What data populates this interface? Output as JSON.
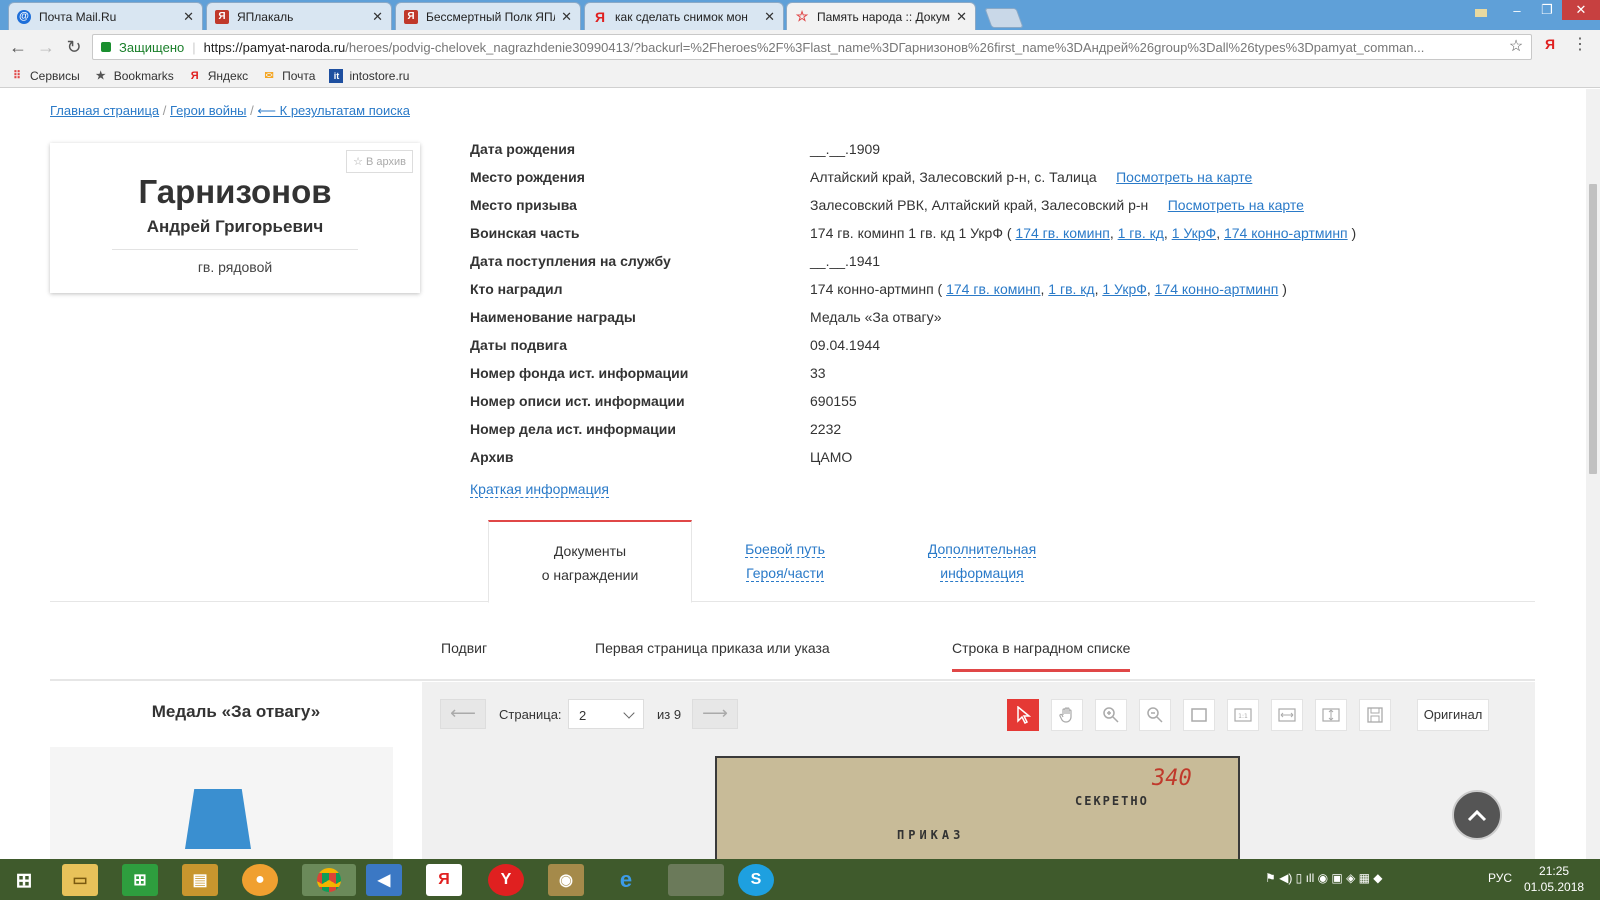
{
  "browser": {
    "tabs": [
      {
        "title": "Почта Mail.Ru",
        "icon": "mail-icon"
      },
      {
        "title": "ЯПлакаль",
        "icon": "yaplakal-icon"
      },
      {
        "title": "Бессмертный Полк ЯПл",
        "icon": "yaplakal-icon"
      },
      {
        "title": "как сделать снимок мон",
        "icon": "yandex-icon"
      },
      {
        "title": "Память народа :: Докум",
        "icon": "star-icon"
      }
    ],
    "secure_label": "Защищено",
    "url_host": "https://pamyat-naroda.ru",
    "url_rest": "/heroes/podvig-chelovek_nagrazhdenie30990413/?backurl=%2Fheroes%2F%3Flast_name%3DГарнизонов%26first_name%3DАндрей%26group%3Dall%26types%3Dpamyat_comman...",
    "bookmarks": [
      "Сервисы",
      "Bookmarks",
      "Яндекс",
      "Почта",
      "intostore.ru"
    ]
  },
  "breadcrumbs": {
    "home": "Главная страница",
    "sep1": "/",
    "heroes": "Герои войны",
    "sep2": "/",
    "back": "⟵ К результатам поиска"
  },
  "person": {
    "archive_button": "☆ В архив",
    "surname": "Гарнизонов",
    "name": "Андрей Григорьевич",
    "rank": "гв. рядовой"
  },
  "info": [
    {
      "label": "Дата рождения",
      "value": "__.__.1909"
    },
    {
      "label": "Место рождения",
      "value": "Алтайский край, Залесовский р-н, с. Талица",
      "link": "Посмотреть на карте"
    },
    {
      "label": "Место призыва",
      "value": "Залесовский РВК, Алтайский край, Залесовский р-н",
      "link": "Посмотреть на карте"
    },
    {
      "label": "Воинская часть",
      "value": "174 гв. коминп 1 гв. кд 1 УкрФ (",
      "links": [
        "174 гв. коминп",
        "1 гв. кд",
        "1 УкрФ",
        "174 конно-артминп"
      ],
      "tail": ")"
    },
    {
      "label": "Дата поступления на службу",
      "value": "__.__.1941"
    },
    {
      "label": "Кто наградил",
      "value": "174 конно-артминп (",
      "links": [
        "174 гв. коминп",
        "1 гв. кд",
        "1 УкрФ",
        "174 конно-артминп"
      ],
      "tail": ")"
    },
    {
      "label": "Наименование награды",
      "value": "Медаль «За отвагу»"
    },
    {
      "label": "Даты подвига",
      "value": "09.04.1944"
    },
    {
      "label": "Номер фонда ист. информации",
      "value": "33"
    },
    {
      "label": "Номер описи ист. информации",
      "value": "690155"
    },
    {
      "label": "Номер дела ист. информации",
      "value": "2232"
    },
    {
      "label": "Архив",
      "value": "ЦАМО"
    }
  ],
  "short_info_link": "Краткая информация",
  "tabs": [
    {
      "line1": "Документы",
      "line2": "о награждении"
    },
    {
      "line1": "Боевой путь",
      "line2": "Героя/части"
    },
    {
      "line1": "Дополнительная",
      "line2": "информация"
    }
  ],
  "subtabs": [
    "Подвиг",
    "Первая страница приказа или указа",
    "Строка в наградном списке"
  ],
  "medal_title": "Медаль «За отвагу»",
  "viewer": {
    "page_label": "Страница:",
    "page_value": "2",
    "of_label": "из 9",
    "original_button": "Оригинал",
    "doc_text": [
      "СЕКРЕТНО",
      "ПРИКАЗ",
      "340"
    ]
  },
  "taskbar": {
    "lang": "РУС",
    "time": "21:25",
    "date": "01.05.2018"
  },
  "colors": {
    "accent_red": "#e04747",
    "link_blue": "#2a7ac8"
  }
}
